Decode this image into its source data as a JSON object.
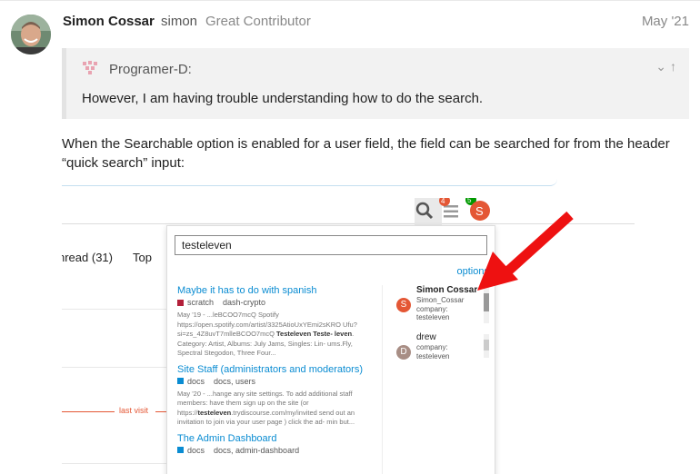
{
  "post": {
    "username": "Simon Cossar",
    "handle": "simon",
    "user_title": "Great Contributor",
    "date": "May '21",
    "text": "When the Searchable option is enabled for a user field, the field can be searched for from the header “quick search” input:"
  },
  "quote": {
    "author": "Programer-D:",
    "text": "However, I am having trouble understanding how to do the search."
  },
  "screenshot": {
    "nav_unread": "nread (31)",
    "nav_top": "Top",
    "last_visit": "last visit",
    "badge_notifications": "4",
    "badge_messages": "5",
    "user_avatar_letter": "S",
    "search_value": "testeleven",
    "options_link": "options",
    "results": [
      {
        "title": "Maybe it has to do with spanish",
        "category": "scratch",
        "tags": "dash-crypto",
        "category_color": "#b3203a",
        "blurb_pre": "May '19 - ...leBCOO7mcQ Spotify https://open.spotify.com/artist/3325AtioUxYEmi2sKRO Ufu?si=zs_4Z8uvT7mlleBCOO7mcQ ",
        "blurb_bold": "Testeleven Teste- leven",
        "blurb_post": ". Category: Artist, Albums: July Jams, Singles: Lin- ums.Fly, Spectral Stegodon, Three Four..."
      },
      {
        "title": "Site Staff (administrators and moderators)",
        "category": "docs",
        "tags": "docs, users",
        "category_color": "#0a8cd2",
        "blurb_pre": "May '20 - ...hange any site settings. To add additional staff members: have them sign up on the site (or https://",
        "blurb_bold": "testeleven",
        "blurb_post": ".trydiscourse.com/my/invited send out an invitation to join via your user page ) click the ad- min but..."
      },
      {
        "title": "The Admin Dashboard",
        "category": "docs",
        "tags": "docs, admin-dashboard",
        "category_color": "#0a8cd2",
        "blurb_pre": "",
        "blurb_bold": "",
        "blurb_post": ""
      }
    ],
    "users": [
      {
        "letter": "S",
        "name": "Simon Cossar",
        "username": "Simon_Cossar",
        "field_label": "company:",
        "field_value": "testeleven",
        "color": "#e45735"
      },
      {
        "letter": "D",
        "name": "drew",
        "username": "",
        "field_label": "company:",
        "field_value": "testeleven",
        "color": "#a88e85"
      }
    ]
  },
  "colors": {
    "link": "#0a8cd2",
    "badge_red": "#e45735",
    "badge_green": "#009900",
    "arrow": "#ee1111"
  }
}
